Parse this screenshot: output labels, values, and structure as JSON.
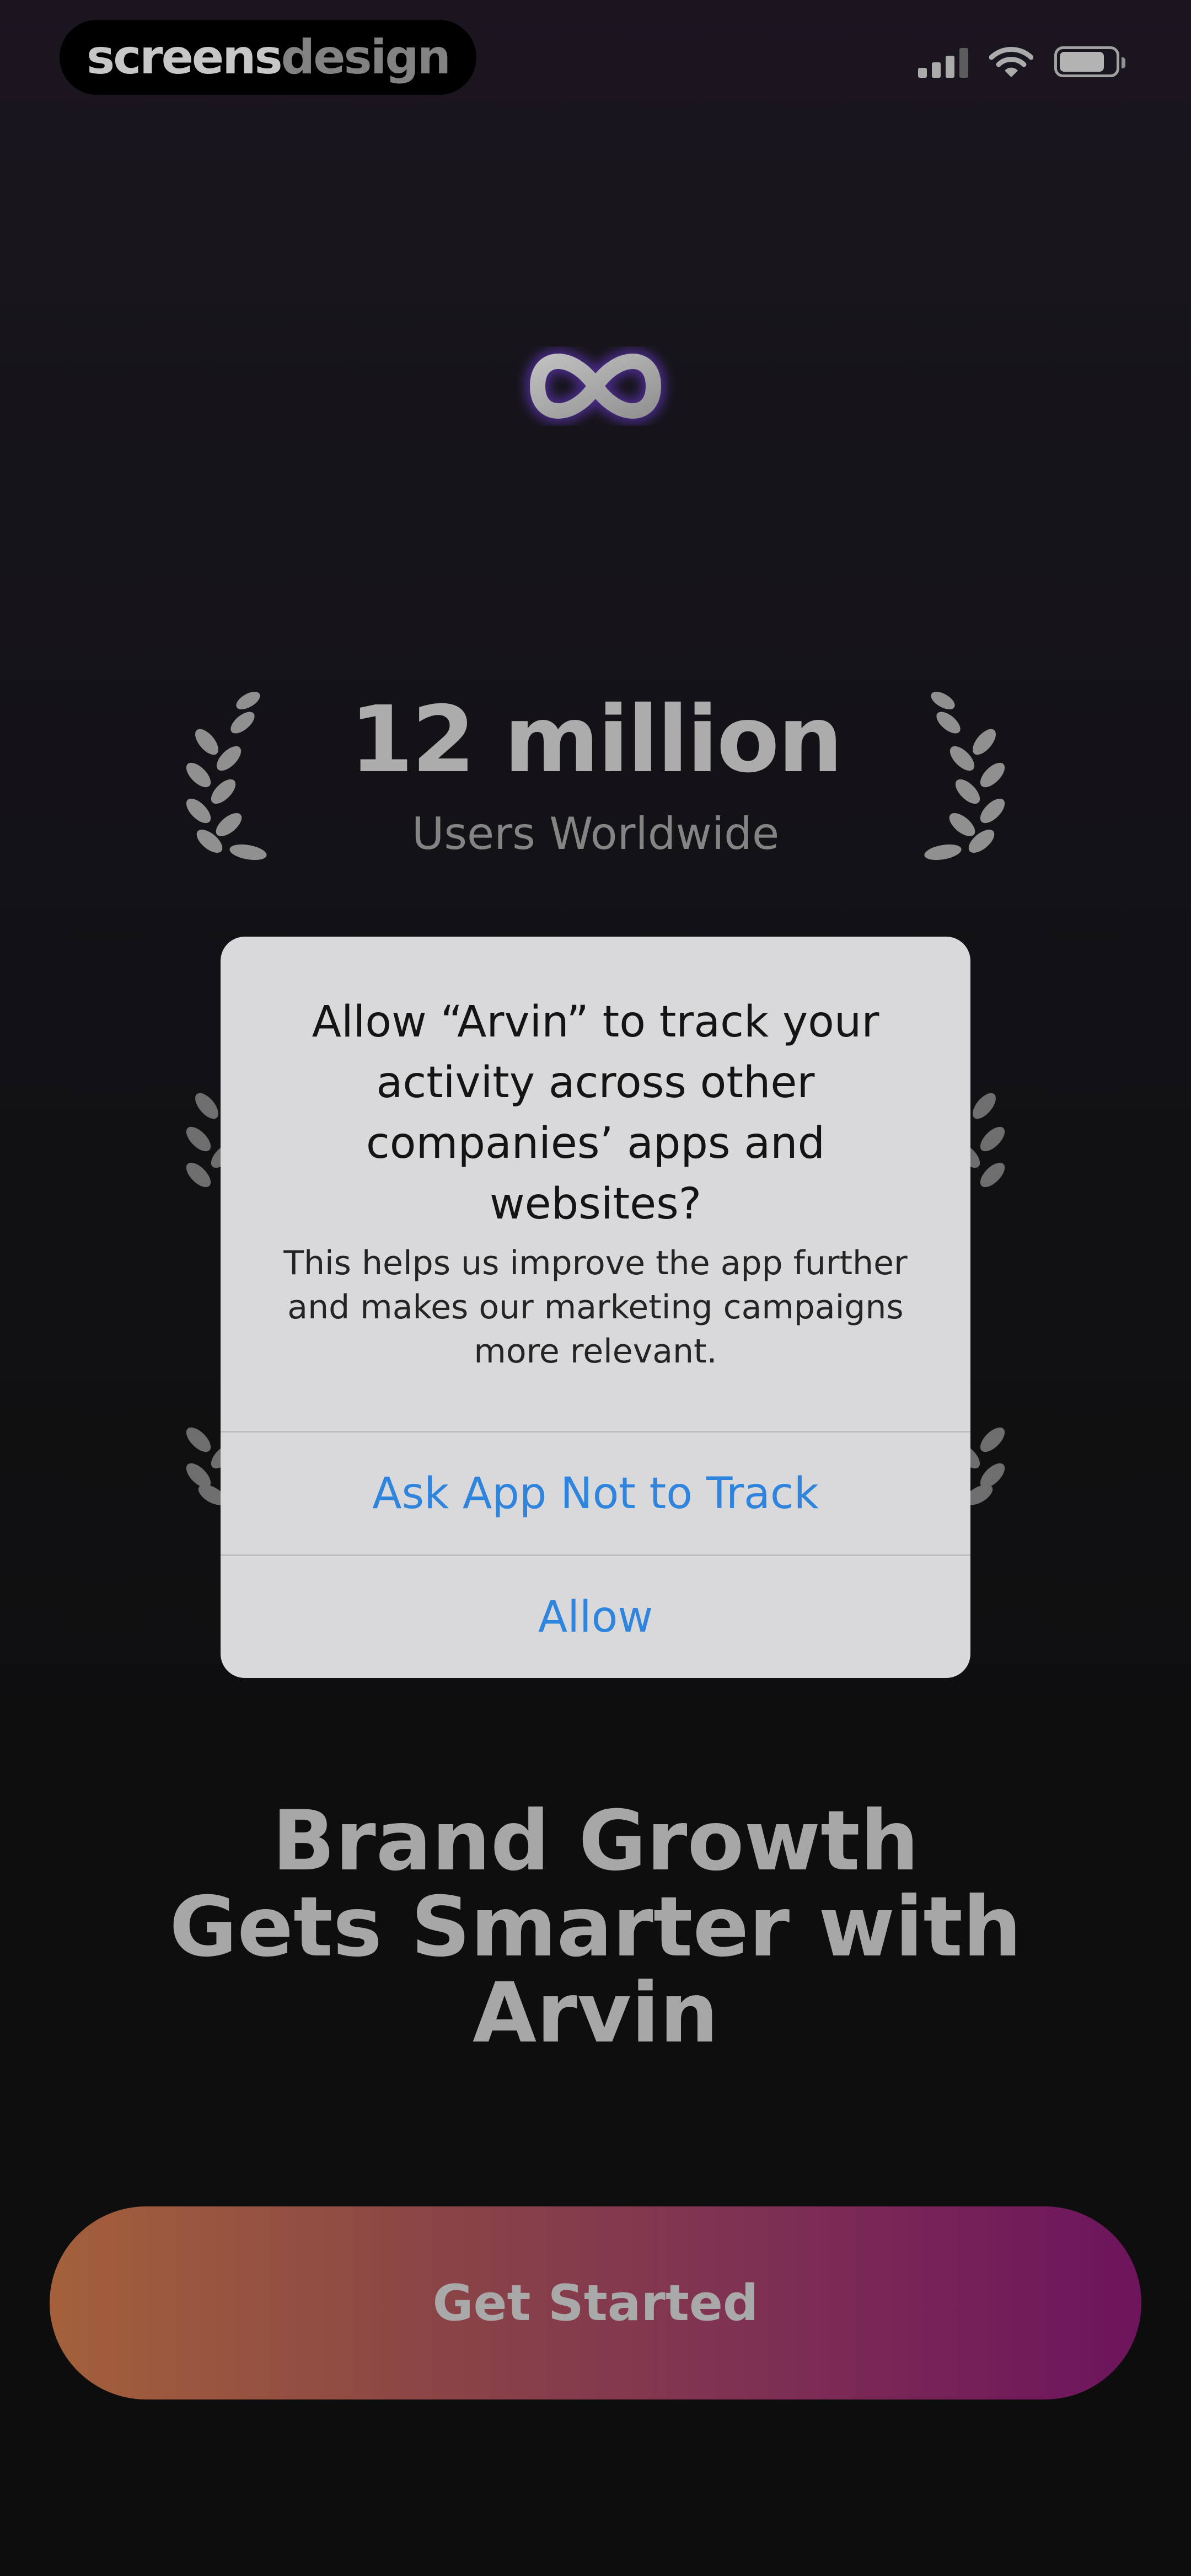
{
  "watermark": {
    "part1": "screens",
    "part2": "design"
  },
  "status_bar": {
    "signal": "signal-icon",
    "wifi": "wifi-icon",
    "battery": "battery-icon"
  },
  "app": {
    "logo": "infinity-logo-icon"
  },
  "stats": {
    "value": "12 million",
    "label": "Users Worldwide"
  },
  "headline": "Brand Growth\nGets Smarter with\nArvin",
  "cta": {
    "label": "Get Started"
  },
  "alert": {
    "title": "Allow “Arvin” to track your activity across other companies’ apps and websites?",
    "message": "This helps us improve the app further and makes our marketing campaigns more relevant.",
    "buttons": [
      "Ask App Not to Track",
      "Allow"
    ]
  },
  "colors": {
    "cta_start": "#d27c4c",
    "cta_end": "#8c1a78",
    "alert_button_text": "#2f84dd",
    "alert_background": "#d9d9db",
    "logo_glow": "#6a3cc8"
  }
}
